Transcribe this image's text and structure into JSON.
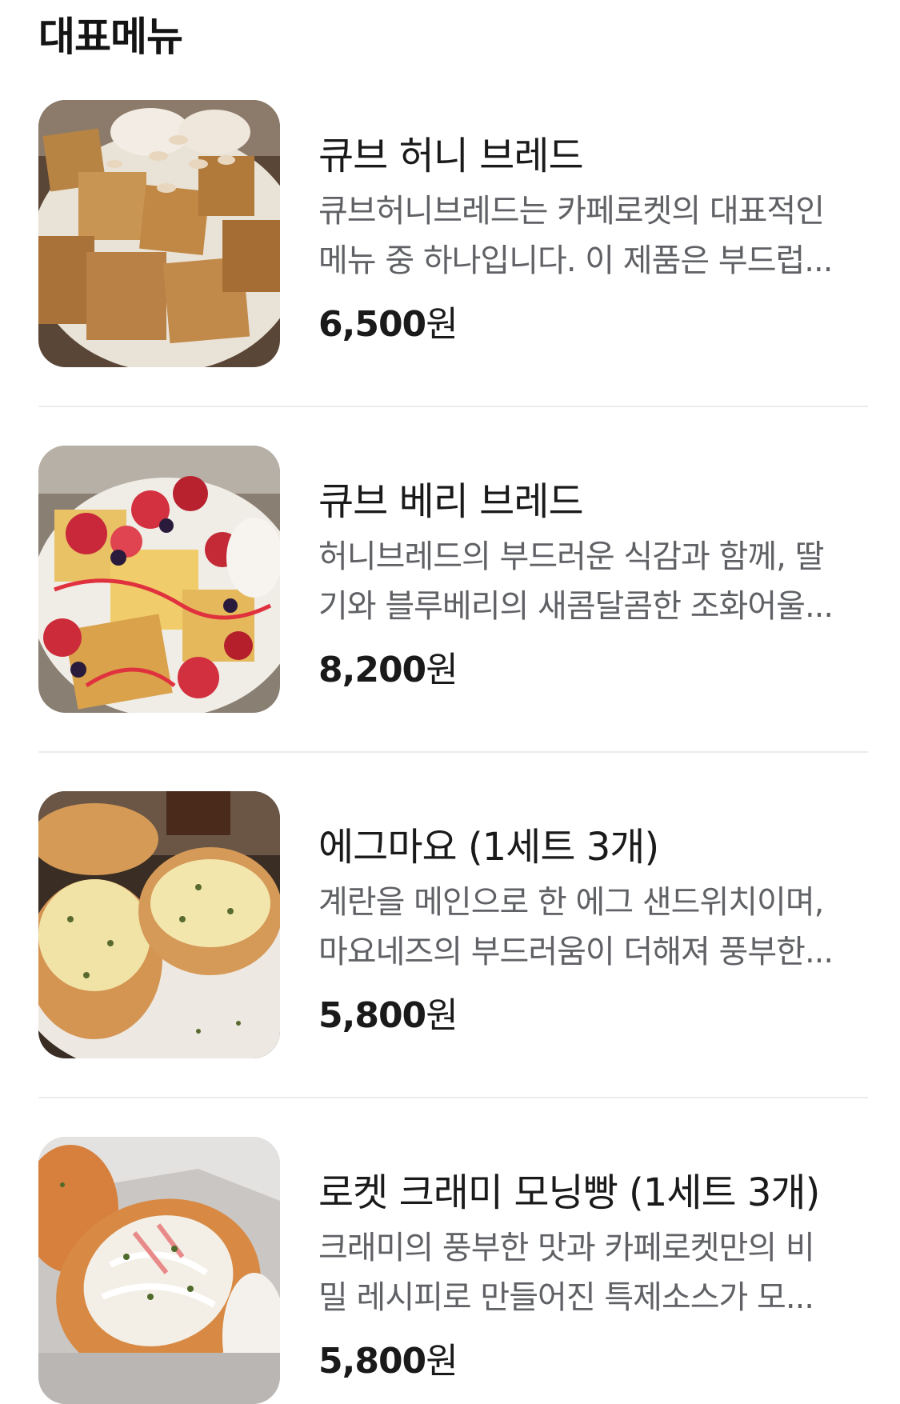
{
  "section": {
    "title": "대표메뉴"
  },
  "menu": [
    {
      "name": "큐브 허니 브레드",
      "desc1": "큐브허니브레드는 카페로켓의 대표적인",
      "desc2": "메뉴 중 하나입니다. 이 제품은 부드럽...",
      "price": "6,500",
      "currency": "원",
      "image": "honey-bread-photo"
    },
    {
      "name": "큐브 베리 브레드",
      "desc1": "허니브레드의 부드러운 식감과 함께, 딸",
      "desc2": "기와 블루베리의 새콤달콤한 조화어울...",
      "price": "8,200",
      "currency": "원",
      "image": "berry-bread-photo"
    },
    {
      "name": "에그마요 (1세트 3개)",
      "desc1": "계란을 메인으로 한 에그 샌드위치이며,",
      "desc2": "마요네즈의 부드러움이 더해져 풍부한...",
      "price": "5,800",
      "currency": "원",
      "image": "egg-mayo-photo"
    },
    {
      "name": "로켓 크래미 모닝빵 (1세트 3개)",
      "desc1": "크래미의 풍부한 맛과 카페로켓만의 비",
      "desc2": "밀 레시피로 만들어진 특제소스가 모...",
      "price": "5,800",
      "currency": "원",
      "image": "crab-morning-bread-photo"
    }
  ]
}
